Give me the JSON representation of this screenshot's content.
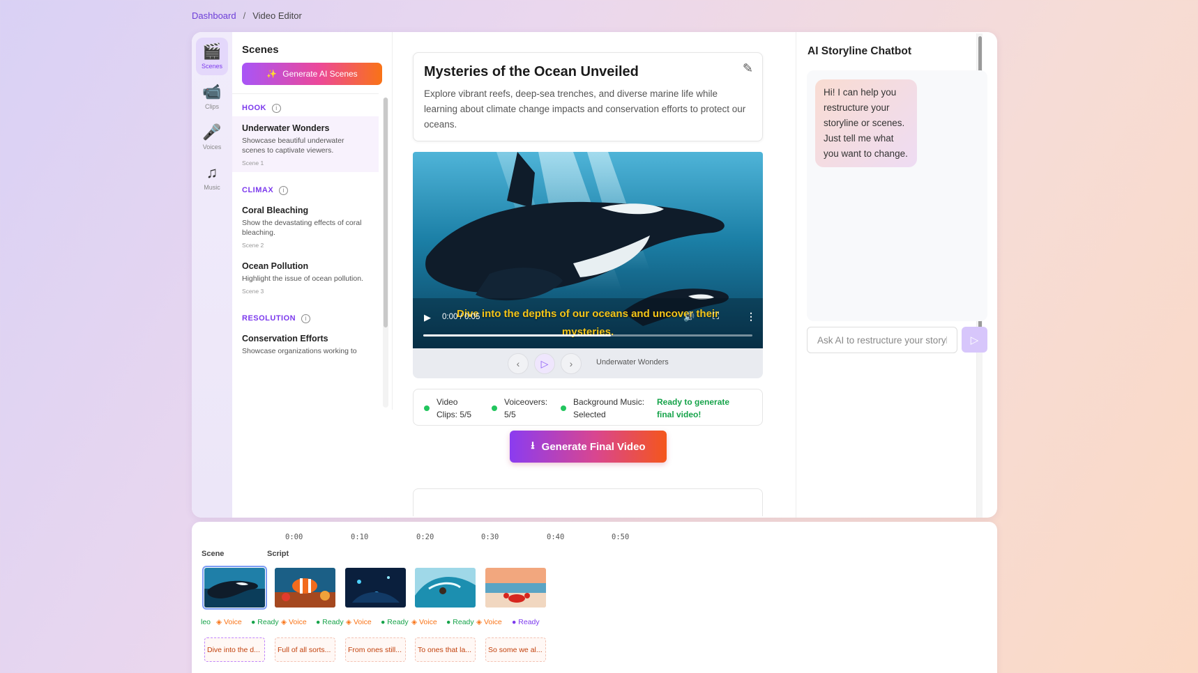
{
  "breadcrumb": {
    "root": "Dashboard",
    "separator": "/",
    "current": "Video Editor"
  },
  "rail": [
    {
      "label": "Scenes",
      "icon": "clapperboard-icon",
      "glyph": "🎬",
      "active": true
    },
    {
      "label": "Clips",
      "icon": "video-camera-icon",
      "glyph": "📹",
      "active": false
    },
    {
      "label": "Voices",
      "icon": "microphone-icon",
      "glyph": "🎤",
      "active": false
    },
    {
      "label": "Music",
      "icon": "music-note-icon",
      "glyph": "♫",
      "active": false
    }
  ],
  "scenes_panel": {
    "title": "Scenes",
    "generate_button": "Generate AI Scenes",
    "sections": [
      {
        "name": "HOOK",
        "scenes": [
          {
            "title": "Underwater Wonders",
            "desc": "Showcase beautiful underwater scenes to captivate viewers.",
            "num": "Scene 1",
            "selected": true
          }
        ]
      },
      {
        "name": "CLIMAX",
        "scenes": [
          {
            "title": "Coral Bleaching",
            "desc": "Show the devastating effects of coral bleaching.",
            "num": "Scene 2"
          },
          {
            "title": "Ocean Pollution",
            "desc": "Highlight the issue of ocean pollution.",
            "num": "Scene 3"
          }
        ]
      },
      {
        "name": "RESOLUTION",
        "scenes": [
          {
            "title": "Conservation Efforts",
            "desc": "Showcase organizations working to"
          }
        ]
      }
    ]
  },
  "video": {
    "title": "Mysteries of the Ocean Unveiled",
    "description": "Explore vibrant reefs, deep-sea trenches, and diverse marine life while learning about climate change impacts and conservation efforts to protect our oceans.",
    "caption_line1": "Dive into the depths of our oceans and uncover their",
    "caption_line2": "mysteries.",
    "time": "0:00 / 0:05",
    "progress": 0.57,
    "current_scene": "Underwater Wonders"
  },
  "status": {
    "clips_label": "Video",
    "clips_value": "Clips: 5/5",
    "voice_label": "Voiceovers:",
    "voice_value": "5/5",
    "music_label": "Background Music:",
    "music_value": "Selected",
    "ready_line1": "Ready to generate",
    "ready_line2": "final video!"
  },
  "final_button": "Generate Final Video",
  "chat": {
    "title": "AI Storyline Chatbot",
    "message": "Hi! I can help you restructure your storyline or scenes. Just tell me what you want to change.",
    "placeholder": "Ask AI to restructure your storyline..."
  },
  "timeline": {
    "ticks": [
      "0:00",
      "0:10",
      "0:20",
      "0:30",
      "0:40",
      "0:50"
    ],
    "track_labels": [
      "Scene",
      "Script"
    ],
    "voice_prefix": "leo",
    "voice_label": "Voice",
    "ready_label": "Ready",
    "scripts": [
      "Dive into the d...",
      "Full of all sorts...",
      "From ones still...",
      "To ones that la...",
      "So some we al..."
    ],
    "selected_index": 0
  },
  "colors": {
    "accent": "#7c3aed",
    "ready_green": "#16a34a",
    "voice_orange": "#f97316"
  }
}
